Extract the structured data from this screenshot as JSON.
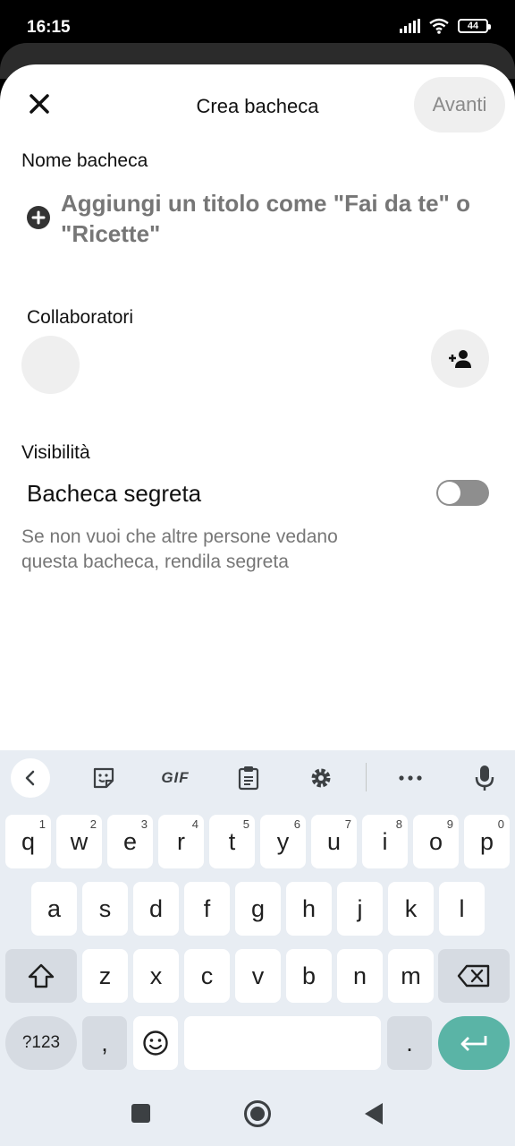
{
  "status_bar": {
    "time": "16:15",
    "battery": "44",
    "icons": [
      "signal-icon",
      "wifi-icon",
      "battery-icon"
    ]
  },
  "header": {
    "title": "Crea bacheca",
    "next_label": "Avanti",
    "close_icon": "close-icon"
  },
  "board_name": {
    "label": "Nome bacheca",
    "placeholder": "Aggiungi un titolo come \"Fai da te\" o \"Ricette\""
  },
  "collaborators": {
    "label": "Collaboratori",
    "add_icon": "add-person-icon"
  },
  "visibility": {
    "label": "Visibilità",
    "secret_label": "Bacheca segreta",
    "secret_enabled": false,
    "description": "Se non vuoi che altre persone vedano questa bacheca, rendila segreta"
  },
  "keyboard": {
    "toolbar": {
      "gif_label": "GIF",
      "icons": [
        "chevron-left-icon",
        "sticker-icon",
        "clipboard-icon",
        "settings-icon",
        "more-icon",
        "microphone-icon"
      ]
    },
    "row1": [
      {
        "k": "q",
        "h": "1"
      },
      {
        "k": "w",
        "h": "2"
      },
      {
        "k": "e",
        "h": "3"
      },
      {
        "k": "r",
        "h": "4"
      },
      {
        "k": "t",
        "h": "5"
      },
      {
        "k": "y",
        "h": "6"
      },
      {
        "k": "u",
        "h": "7"
      },
      {
        "k": "i",
        "h": "8"
      },
      {
        "k": "o",
        "h": "9"
      },
      {
        "k": "p",
        "h": "0"
      }
    ],
    "row2": [
      "a",
      "s",
      "d",
      "f",
      "g",
      "h",
      "j",
      "k",
      "l"
    ],
    "row3": [
      "z",
      "x",
      "c",
      "v",
      "b",
      "n",
      "m"
    ],
    "bottom": {
      "symbols_label": "?123",
      "comma": ",",
      "period": "."
    }
  },
  "accent_colors": {
    "enter_key": "#5ab4a6",
    "toggle_track": "#8e8e8e"
  }
}
